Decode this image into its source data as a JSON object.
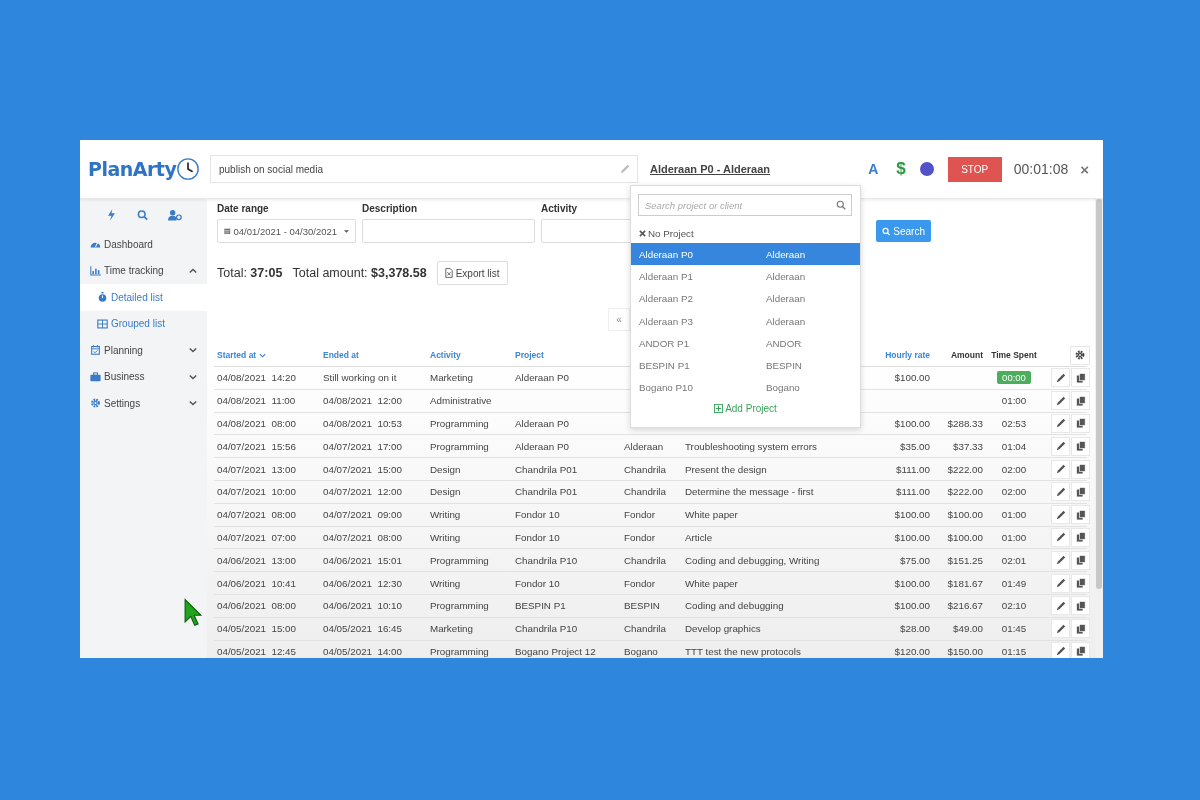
{
  "logo": "PlanArty",
  "timer_bar": {
    "description": "publish on social media",
    "project_link": "Alderaan P0 - Alderaan",
    "billable_letter": "A",
    "currency_sign": "$",
    "stop_label": "STOP",
    "elapsed": "00:01:08",
    "close": "×"
  },
  "sidebar": {
    "items": [
      {
        "label": "Dashboard"
      },
      {
        "label": "Time tracking",
        "expanded": true,
        "children": [
          {
            "label": "Detailed list",
            "selected": true
          },
          {
            "label": "Grouped list",
            "selected": false
          }
        ]
      },
      {
        "label": "Planning",
        "expanded": false
      },
      {
        "label": "Business",
        "expanded": false
      },
      {
        "label": "Settings",
        "expanded": false
      }
    ]
  },
  "filters": {
    "date_range_label": "Date range",
    "date_range_value": "04/01/2021 - 04/30/2021",
    "description_label": "Description",
    "activity_label": "Activity",
    "search_button": "Search"
  },
  "totals": {
    "text": "Total: **37:05**   Total amount: **$3,378.58**",
    "export_button": "Export list"
  },
  "pagination": {
    "first": "«"
  },
  "table": {
    "columns": [
      {
        "label": "Started at",
        "link": true,
        "sorted": true
      },
      {
        "label": "Ended at",
        "link": true,
        "sorted": false
      },
      {
        "label": "Activity",
        "link": true,
        "sorted": false
      },
      {
        "label": "Project",
        "link": true,
        "sorted": false
      },
      {
        "label": "Hourly rate",
        "link": true,
        "sorted": false
      },
      {
        "label": "Amount",
        "link": false,
        "sorted": false
      },
      {
        "label": "Time Spent",
        "link": false,
        "sorted": false
      }
    ],
    "rows": [
      {
        "started": "04/08/2021  14:20",
        "ended": "Still working on it",
        "activity": "Marketing",
        "project": "Alderaan P0",
        "rate": "$100.00",
        "time": "00:00",
        "running": true
      },
      {
        "started": "04/08/2021  11:00",
        "ended": "04/08/2021  12:00",
        "activity": "Administrative",
        "time": "01:00",
        "running": false
      },
      {
        "started": "04/08/2021  08:00",
        "ended": "04/08/2021  10:53",
        "activity": "Programming",
        "project": "Alderaan P0",
        "rate": "$100.00",
        "amount": "$288.33",
        "time": "02:53",
        "running": false
      },
      {
        "started": "04/07/2021  15:56",
        "ended": "04/07/2021  17:00",
        "activity": "Programming",
        "project": "Alderaan P0",
        "client": "Alderaan",
        "description": "Troubleshooting system errors",
        "rate": "$35.00",
        "amount": "$37.33",
        "time": "01:04",
        "running": false
      },
      {
        "started": "04/07/2021  13:00",
        "ended": "04/07/2021  15:00",
        "activity": "Design",
        "project": "Chandrila P01",
        "client": "Chandrila",
        "description": "Present the design",
        "rate": "$111.00",
        "amount": "$222.00",
        "time": "02:00",
        "running": false
      },
      {
        "started": "04/07/2021  10:00",
        "ended": "04/07/2021  12:00",
        "activity": "Design",
        "project": "Chandrila P01",
        "client": "Chandrila",
        "description": "Determine the message - first",
        "rate": "$111.00",
        "amount": "$222.00",
        "time": "02:00",
        "running": false
      },
      {
        "started": "04/07/2021  08:00",
        "ended": "04/07/2021  09:00",
        "activity": "Writing",
        "project": "Fondor 10",
        "client": "Fondor",
        "description": "White paper",
        "rate": "$100.00",
        "amount": "$100.00",
        "time": "01:00",
        "running": false
      },
      {
        "started": "04/07/2021  07:00",
        "ended": "04/07/2021  08:00",
        "activity": "Writing",
        "project": "Fondor 10",
        "client": "Fondor",
        "description": "Article",
        "rate": "$100.00",
        "amount": "$100.00",
        "time": "01:00",
        "running": false
      },
      {
        "started": "04/06/2021  13:00",
        "ended": "04/06/2021  15:01",
        "activity": "Programming",
        "project": "Chandrila P10",
        "client": "Chandrila",
        "description": "Coding and debugging, Writing",
        "rate": "$75.00",
        "amount": "$151.25",
        "time": "02:01",
        "running": false
      },
      {
        "started": "04/06/2021  10:41",
        "ended": "04/06/2021  12:30",
        "activity": "Writing",
        "project": "Fondor 10",
        "client": "Fondor",
        "description": "White paper",
        "rate": "$100.00",
        "amount": "$181.67",
        "time": "01:49",
        "running": false
      },
      {
        "started": "04/06/2021  08:00",
        "ended": "04/06/2021  10:10",
        "activity": "Programming",
        "project": "BESPIN P1",
        "client": "BESPIN",
        "description": "Coding and debugging",
        "rate": "$100.00",
        "amount": "$216.67",
        "time": "02:10",
        "running": false
      },
      {
        "started": "04/05/2021  15:00",
        "ended": "04/05/2021  16:45",
        "activity": "Marketing",
        "project": "Chandrila P10",
        "client": "Chandrila",
        "description": "Develop graphics",
        "rate": "$28.00",
        "amount": "$49.00",
        "time": "01:45",
        "running": false
      },
      {
        "started": "04/05/2021  12:45",
        "ended": "04/05/2021  14:00",
        "activity": "Programming",
        "project": "Bogano Project 12",
        "client": "Bogano",
        "description": "TTT test the new protocols",
        "rate": "$120.00",
        "amount": "$150.00",
        "time": "01:15",
        "running": false
      }
    ]
  },
  "project_dropdown": {
    "placeholder": "Search project or client",
    "no_project": "No Project",
    "options": [
      {
        "project": "Alderaan P0",
        "client": "Alderaan",
        "selected": true
      },
      {
        "project": "Alderaan P1",
        "client": "Alderaan",
        "selected": false
      },
      {
        "project": "Alderaan P2",
        "client": "Alderaan",
        "selected": false
      },
      {
        "project": "Alderaan P3",
        "client": "Alderaan",
        "selected": false
      },
      {
        "project": "ANDOR P1",
        "client": "ANDOR",
        "selected": false
      },
      {
        "project": "BESPIN P1",
        "client": "BESPIN",
        "selected": false
      },
      {
        "project": "Bogano P10",
        "client": "Bogano",
        "selected": false
      }
    ],
    "add_project": "Add Project"
  }
}
